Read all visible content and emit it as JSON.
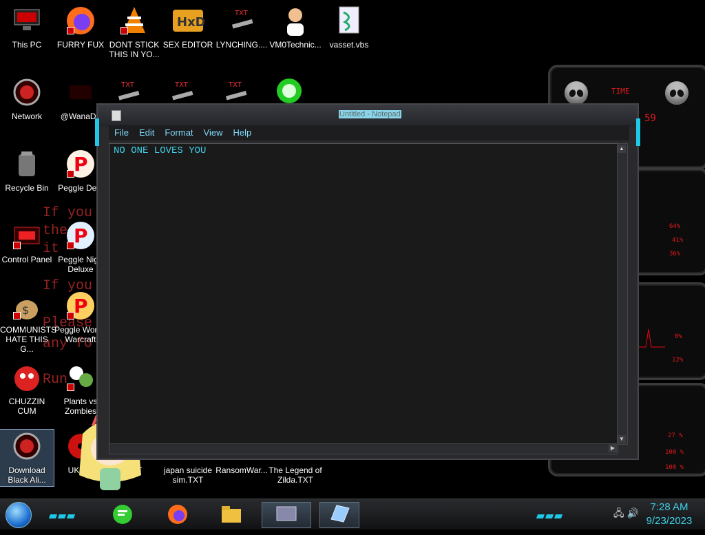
{
  "background_text": [
    "If you",
    "the",
    "it",
    "If you",
    "Please",
    "any fo",
    "Run"
  ],
  "desktop_icons": [
    {
      "label": "This PC"
    },
    {
      "label": "FURRY FUX"
    },
    {
      "label": "DONT STICK THIS IN YO..."
    },
    {
      "label": "SEX EDITOR"
    },
    {
      "label": "LYNCHING...."
    },
    {
      "label": "VM0Technic..."
    },
    {
      "label": "vasset.vbs"
    },
    {
      "label": "Network"
    },
    {
      "label": "@WanaDe"
    },
    {
      "label": "Recycle Bin"
    },
    {
      "label": "Peggle Delu"
    },
    {
      "label": "Control Panel"
    },
    {
      "label": "Peggle Nigh Deluxe"
    },
    {
      "label": "COMMUNISTS HATE THIS G..."
    },
    {
      "label": "Peggle Wor of Warcraft"
    },
    {
      "label": "CHUZZIN CUM"
    },
    {
      "label": "Plants vs Zombies"
    },
    {
      "label": "Download Black Ali..."
    },
    {
      "label": "UKRAI"
    },
    {
      "label": "TXT"
    },
    {
      "label": "japan suicide sim.TXT"
    },
    {
      "label": "RansomWar..."
    },
    {
      "label": "The Legend of Zilda.TXT"
    }
  ],
  "notepad": {
    "title": "Untitled - Notepad",
    "menu": [
      "File",
      "Edit",
      "Format",
      "View",
      "Help"
    ],
    "content": "NO ONE LOVES YOU"
  },
  "widget": {
    "header": "TIME",
    "time_digits": "59",
    "readouts": [
      "64%",
      "41%",
      "36%",
      "0%",
      "12%",
      "27 %",
      "100 %",
      "100 %"
    ]
  },
  "taskbar": {
    "apps": [
      {
        "icon": "chat-app-icon",
        "symbol": "☰"
      },
      {
        "icon": "firefox-icon",
        "symbol": "◉"
      },
      {
        "icon": "file-explorer-icon",
        "symbol": "▭"
      },
      {
        "icon": "window-app-icon",
        "symbol": "▤"
      },
      {
        "icon": "notepad-icon",
        "symbol": "▱"
      }
    ],
    "time": "7:28 AM",
    "date": "9/23/2023"
  },
  "colors": {
    "accent": "#3fd0e8",
    "ransom_red": "#b0282a",
    "widget_red": "#e0181c"
  }
}
